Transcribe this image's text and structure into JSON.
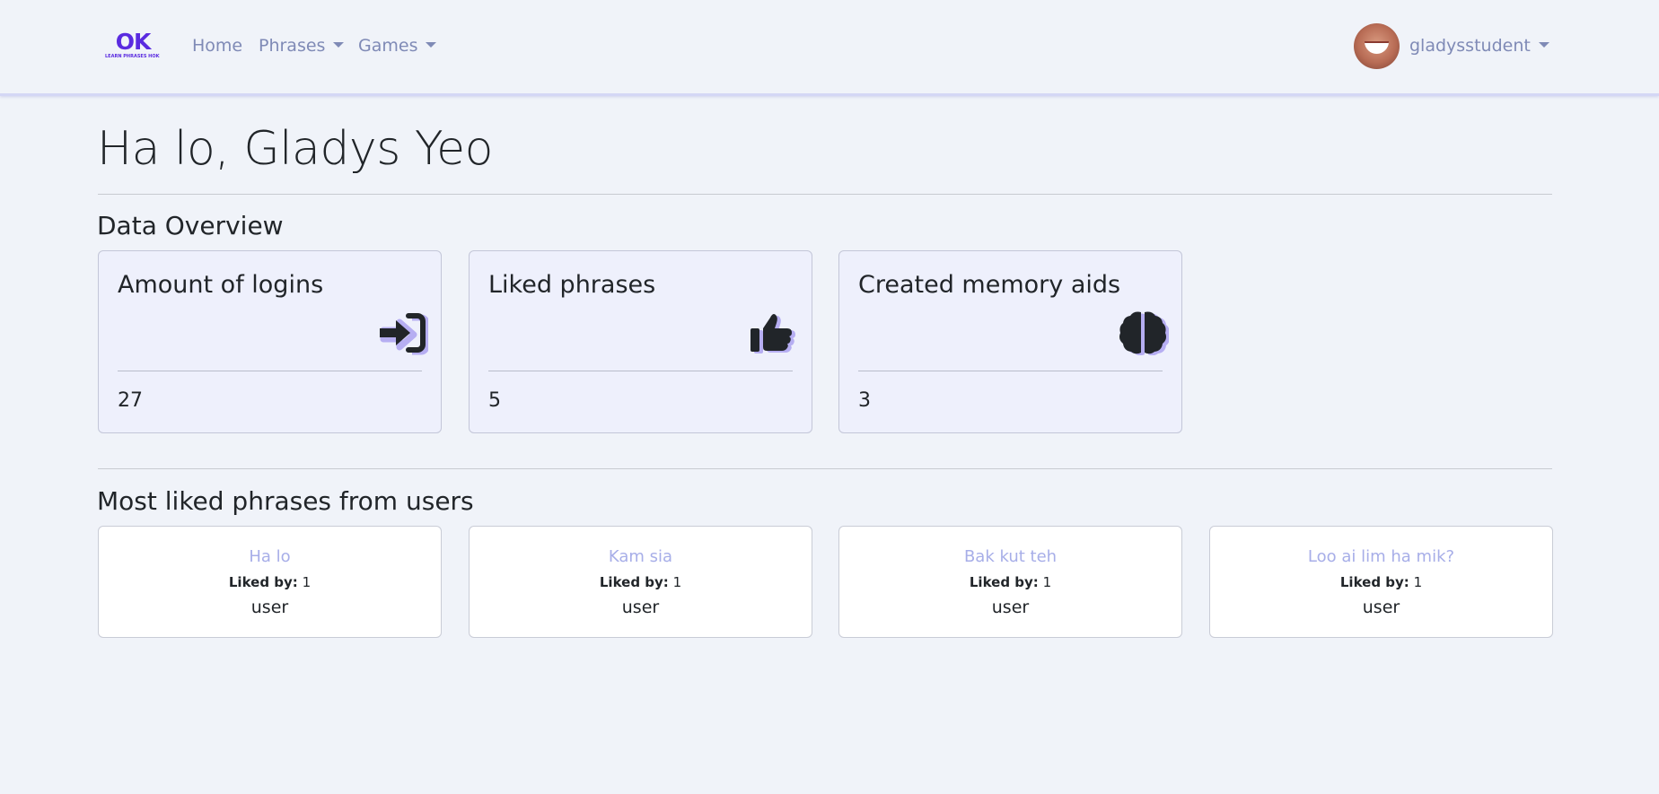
{
  "navbar": {
    "logo": {
      "big": "OK",
      "small": "LEARN PHRASES HOKKIEN"
    },
    "links": [
      {
        "label": "Home"
      },
      {
        "label": "Phrases"
      },
      {
        "label": "Games"
      }
    ],
    "user": {
      "username": "gladysstudent"
    }
  },
  "main": {
    "greeting": "Ha lo, Gladys Yeo",
    "overview_title": "Data Overview",
    "stats": [
      {
        "label": "Amount of logins",
        "value": "27",
        "icon": "login-icon"
      },
      {
        "label": "Liked phrases",
        "value": "5",
        "icon": "thumbs-up-icon"
      },
      {
        "label": "Created memory aids",
        "value": "3",
        "icon": "brain-icon"
      }
    ],
    "liked_title": "Most liked phrases from users",
    "liked_by_label": "Liked by:",
    "phrases": [
      {
        "phrase": "Ha lo",
        "count": "1",
        "unit": "user"
      },
      {
        "phrase": "Kam sia",
        "count": "1",
        "unit": "user"
      },
      {
        "phrase": "Bak kut teh",
        "count": "1",
        "unit": "user"
      },
      {
        "phrase": "Loo ai lim ha mik?",
        "count": "1",
        "unit": "user"
      }
    ]
  },
  "colors": {
    "background": "#f0f3f9",
    "accent": "#5a2be0",
    "link": "#7f8ab6",
    "icon_shadow": "#b6aef2"
  }
}
